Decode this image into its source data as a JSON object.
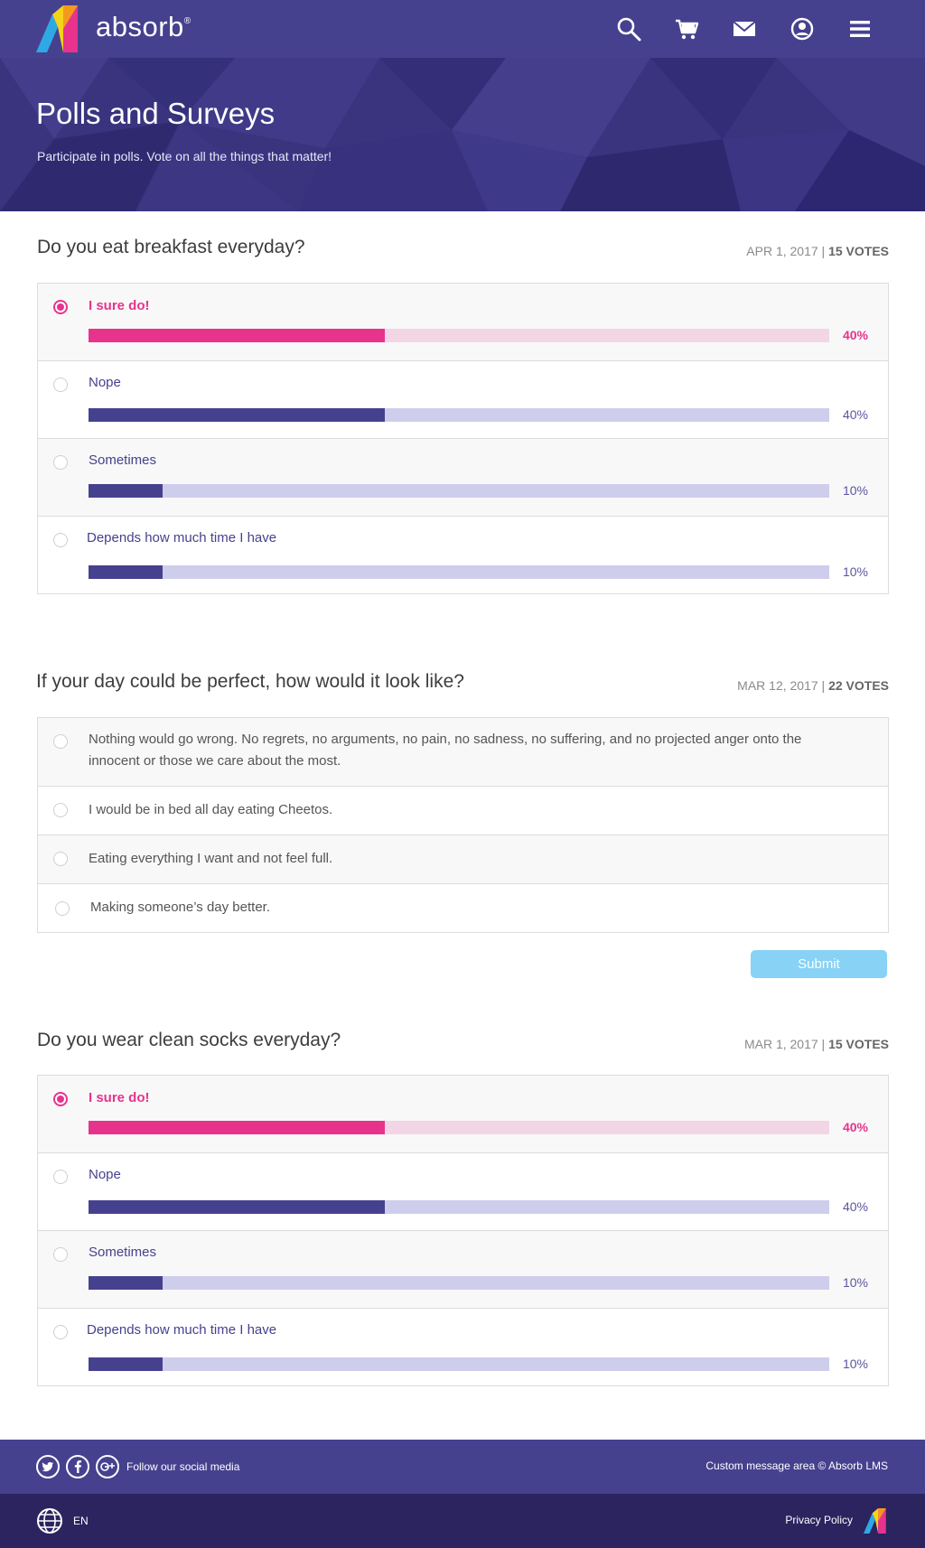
{
  "brand": {
    "name": "absorb",
    "reg_mark": "®"
  },
  "nav": {
    "icons": [
      "search-icon",
      "cart-icon",
      "mail-icon",
      "user-icon",
      "menu-icon"
    ]
  },
  "hero": {
    "title": "Polls and Surveys",
    "subtitle": "Participate in polls. Vote on all the things that matter!"
  },
  "polls": [
    {
      "question": "Do you eat breakfast everyday?",
      "date": "APR 1, 2017",
      "votes": "15 VOTES",
      "options": [
        {
          "label": "I sure do!",
          "percent_text": "40%",
          "percent": 40,
          "selected": true
        },
        {
          "label": "Nope",
          "percent_text": "40%",
          "percent": 40,
          "selected": false
        },
        {
          "label": "Sometimes",
          "percent_text": "10%",
          "percent": 10,
          "selected": false
        },
        {
          "label": "Depends how much time I have",
          "percent_text": "10%",
          "percent": 10,
          "selected": false
        }
      ]
    },
    {
      "question": "If your day could be perfect, how would it look like?",
      "date": "MAR 12, 2017",
      "votes": "22 VOTES",
      "options": [
        {
          "label": "Nothing would go wrong. No regrets, no arguments, no pain, no sadness, no suffering, and no projected anger onto the innocent or those we care about the most."
        },
        {
          "label": "I would be in bed all day eating Cheetos."
        },
        {
          "label": "Eating everything I want and not feel full."
        },
        {
          "label": "Making someone’s day better."
        }
      ],
      "submit_label": "Submit"
    },
    {
      "question": "Do you wear clean socks everyday?",
      "date": "MAR 1, 2017",
      "votes": "15 VOTES",
      "options": [
        {
          "label": "I sure do!",
          "percent_text": "40%",
          "percent": 40,
          "selected": true
        },
        {
          "label": "Nope",
          "percent_text": "40%",
          "percent": 40,
          "selected": false
        },
        {
          "label": "Sometimes",
          "percent_text": "10%",
          "percent": 10,
          "selected": false
        },
        {
          "label": "Depends how much time I have",
          "percent_text": "10%",
          "percent": 10,
          "selected": false
        }
      ]
    }
  ],
  "footer": {
    "social_icons": [
      "twitter-icon",
      "facebook-icon",
      "google-plus-icon"
    ],
    "social_text": "Follow our social media",
    "message": "Custom message area © Absorb LMS",
    "language": "EN",
    "privacy": "Privacy Policy"
  },
  "colors": {
    "primary": "#46418f",
    "accent": "#e8338d",
    "submit": "#87d2f5",
    "footer_dark": "#2b245f"
  }
}
